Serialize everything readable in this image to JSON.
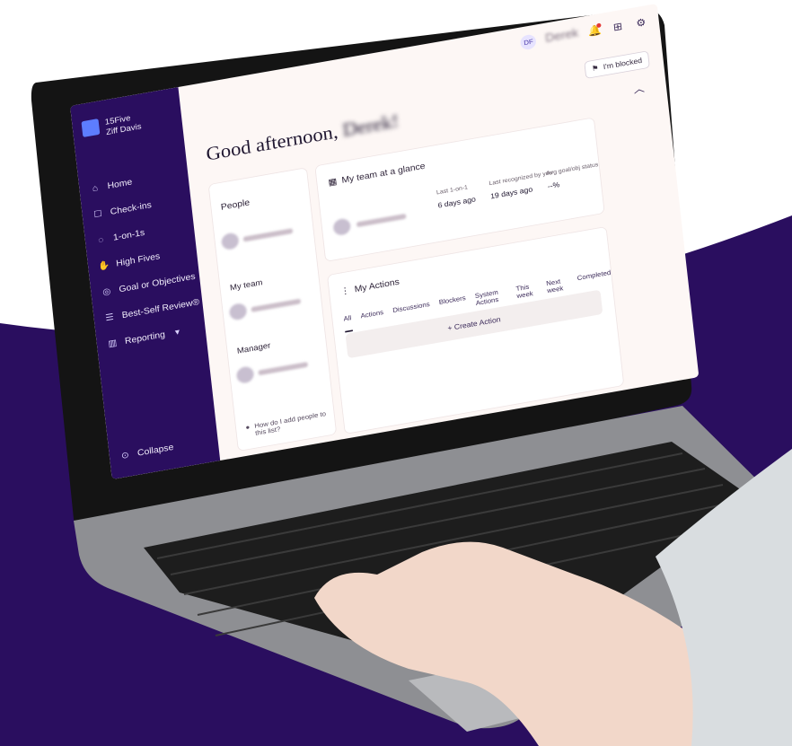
{
  "colors": {
    "accent": "#2a0e5f",
    "background": "#fdf7f5"
  },
  "brand": {
    "line1": "15Five",
    "line2": "Ziff Davis"
  },
  "sidebar": {
    "items": [
      {
        "label": "Home",
        "icon": "home-icon"
      },
      {
        "label": "Check-ins",
        "icon": "checkin-icon"
      },
      {
        "label": "1-on-1s",
        "icon": "chat-icon"
      },
      {
        "label": "High Fives",
        "icon": "highfive-icon"
      },
      {
        "label": "Goal or Objectives",
        "icon": "target-icon"
      },
      {
        "label": "Best-Self Review®",
        "icon": "review-icon"
      },
      {
        "label": "Reporting",
        "icon": "chart-icon"
      }
    ],
    "collapse_label": "Collapse"
  },
  "topbar": {
    "avatar": "DF",
    "user": "Derek"
  },
  "blocked_label": "I'm blocked",
  "greeting": {
    "text": "Good afternoon,",
    "name": "Derek!"
  },
  "people": {
    "title": "People",
    "my_team_label": "My team",
    "manager_label": "Manager",
    "helper": "How do I add people to this list?"
  },
  "glance": {
    "title": "My team at a glance",
    "stats": [
      {
        "label": "Last 1-on-1",
        "value": "6 days ago"
      },
      {
        "label": "Last recognized by you",
        "value": "19 days ago"
      },
      {
        "label": "Avg goal/obj status",
        "value": "--%"
      }
    ]
  },
  "actions": {
    "title": "My Actions",
    "tabs": [
      "All",
      "Actions",
      "Discussions",
      "Blockers",
      "System Actions",
      "This week",
      "Next week",
      "Completed"
    ],
    "create_label": "+ Create Action"
  }
}
